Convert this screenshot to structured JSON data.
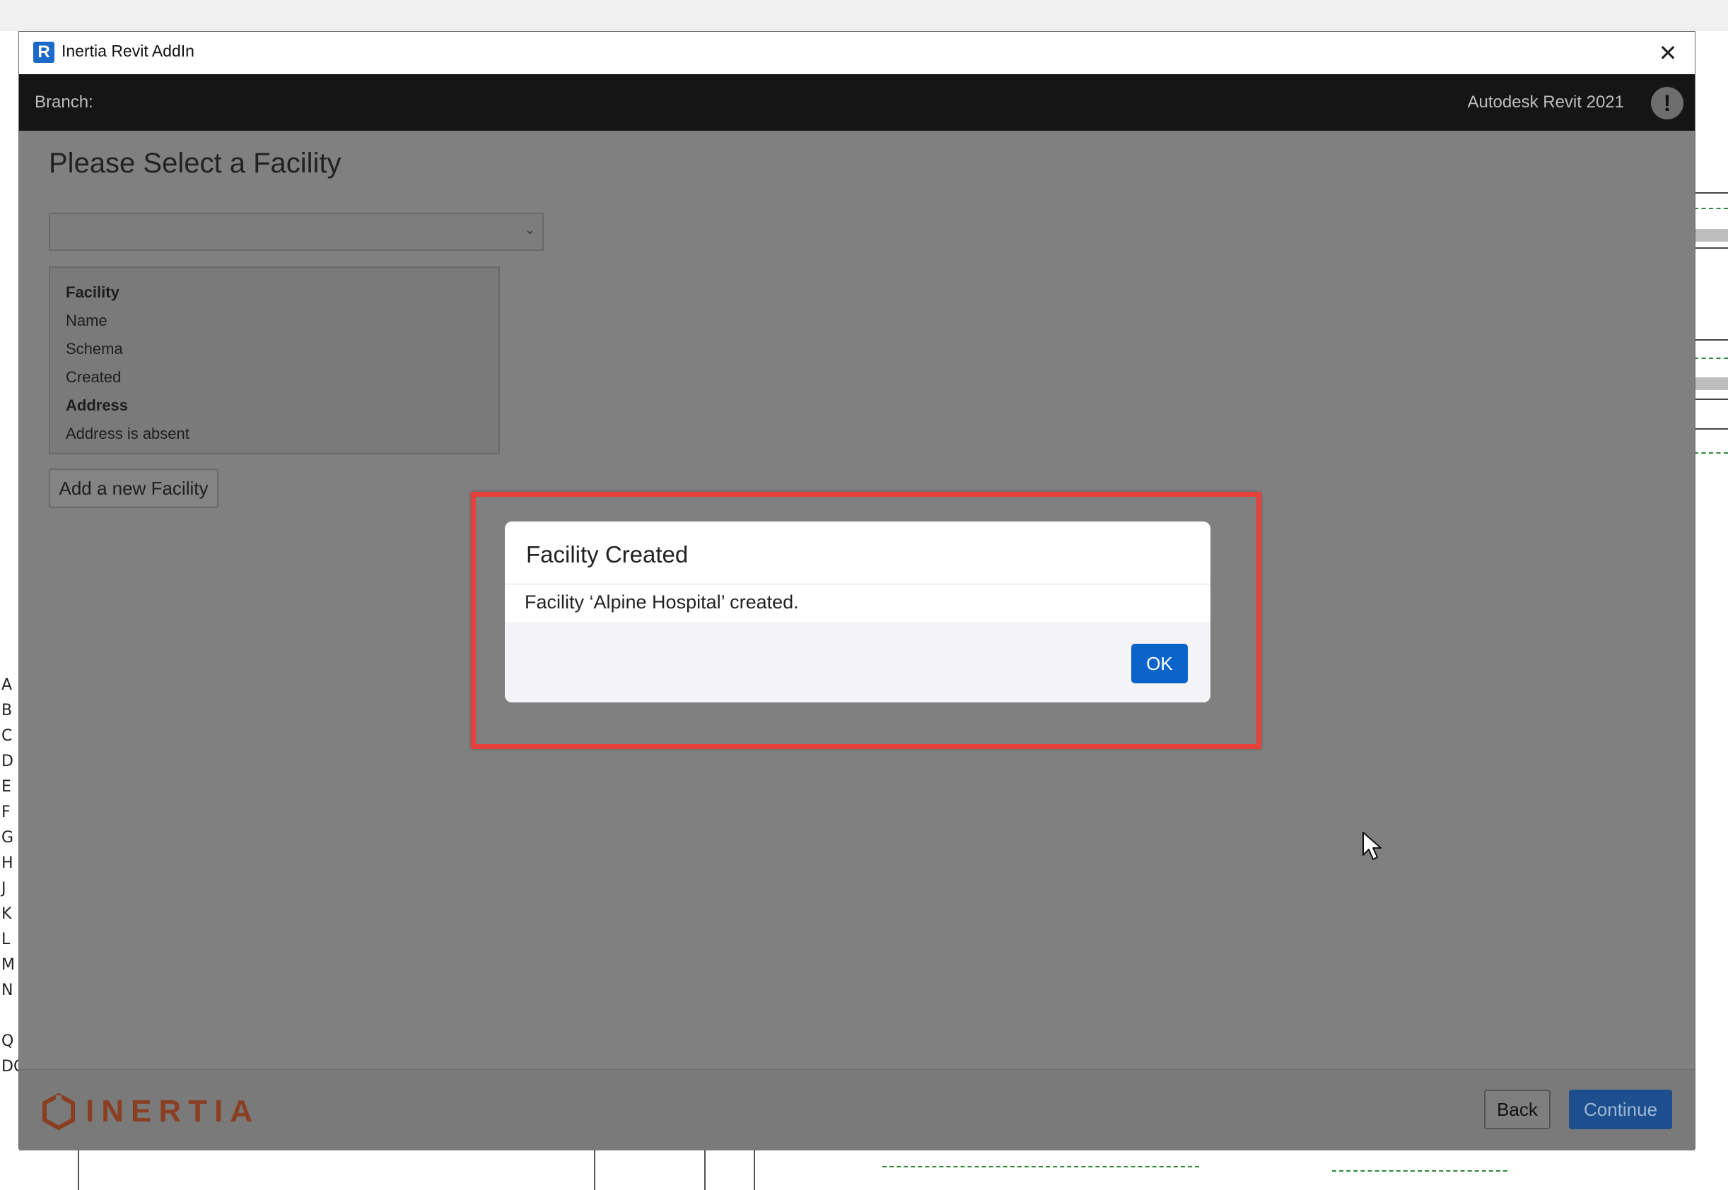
{
  "window": {
    "title": "Inertia Revit AddIn",
    "app_icon_letter": "R",
    "close_symbol": "✕"
  },
  "header": {
    "branch_label": "Branch:",
    "revit_version": "Autodesk Revit 2021",
    "alert_symbol": "!"
  },
  "main": {
    "page_title": "Please Select a Facility",
    "facility_select_value": "",
    "details": [
      {
        "text": "Facility",
        "bold": true
      },
      {
        "text": "Name",
        "bold": false
      },
      {
        "text": "Schema",
        "bold": false
      },
      {
        "text": "Created",
        "bold": false
      },
      {
        "text": "Address",
        "bold": true
      },
      {
        "text": "Address is absent",
        "bold": false
      }
    ],
    "add_facility_label": "Add a new Facility"
  },
  "footer": {
    "logo_text": "INERTIA",
    "back_label": "Back",
    "continue_label": "Continue"
  },
  "modal": {
    "title": "Facility Created",
    "message": "Facility ‘Alpine Hospital’ created.",
    "ok_label": "OK"
  },
  "background": {
    "grid_letters": [
      "A",
      "B",
      "C",
      "D",
      "E",
      "F",
      "G",
      "H",
      "J",
      "K",
      "L",
      "M",
      "N",
      "",
      "Q",
      "DO"
    ]
  },
  "colors": {
    "highlight": "#e8413c",
    "primary_button": "#0a63c9",
    "logo": "#8a3f22"
  }
}
